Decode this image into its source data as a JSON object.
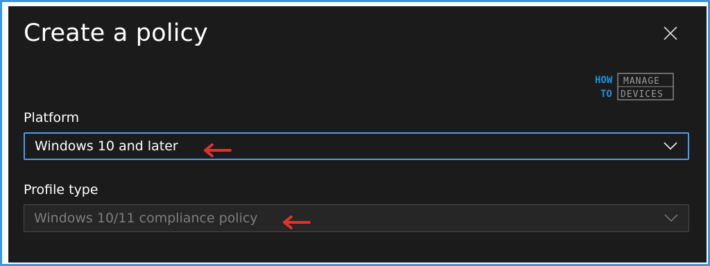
{
  "dialog": {
    "title": "Create a policy",
    "close_label": "close"
  },
  "logo": {
    "line1_left": "HOW",
    "line2_left": "TO",
    "line1_right": "MANAGE",
    "line2_right": "DEVICES"
  },
  "platform": {
    "label": "Platform",
    "selected": "Windows 10 and later",
    "chevron_icon": "chevron-down-icon"
  },
  "profile_type": {
    "label": "Profile type",
    "selected": "Windows 10/11 compliance policy",
    "disabled": true,
    "chevron_icon": "chevron-down-icon"
  },
  "annotations": {
    "arrow_color": "#e0312f",
    "arrow_icon": "left-arrow-icon"
  },
  "colors": {
    "panel_bg": "#1c1b1b",
    "frame_border": "#3a96dd",
    "focus_border": "#479ef5",
    "disabled_text": "#7d7d7d",
    "logo_blue": "#1f8fe0"
  }
}
